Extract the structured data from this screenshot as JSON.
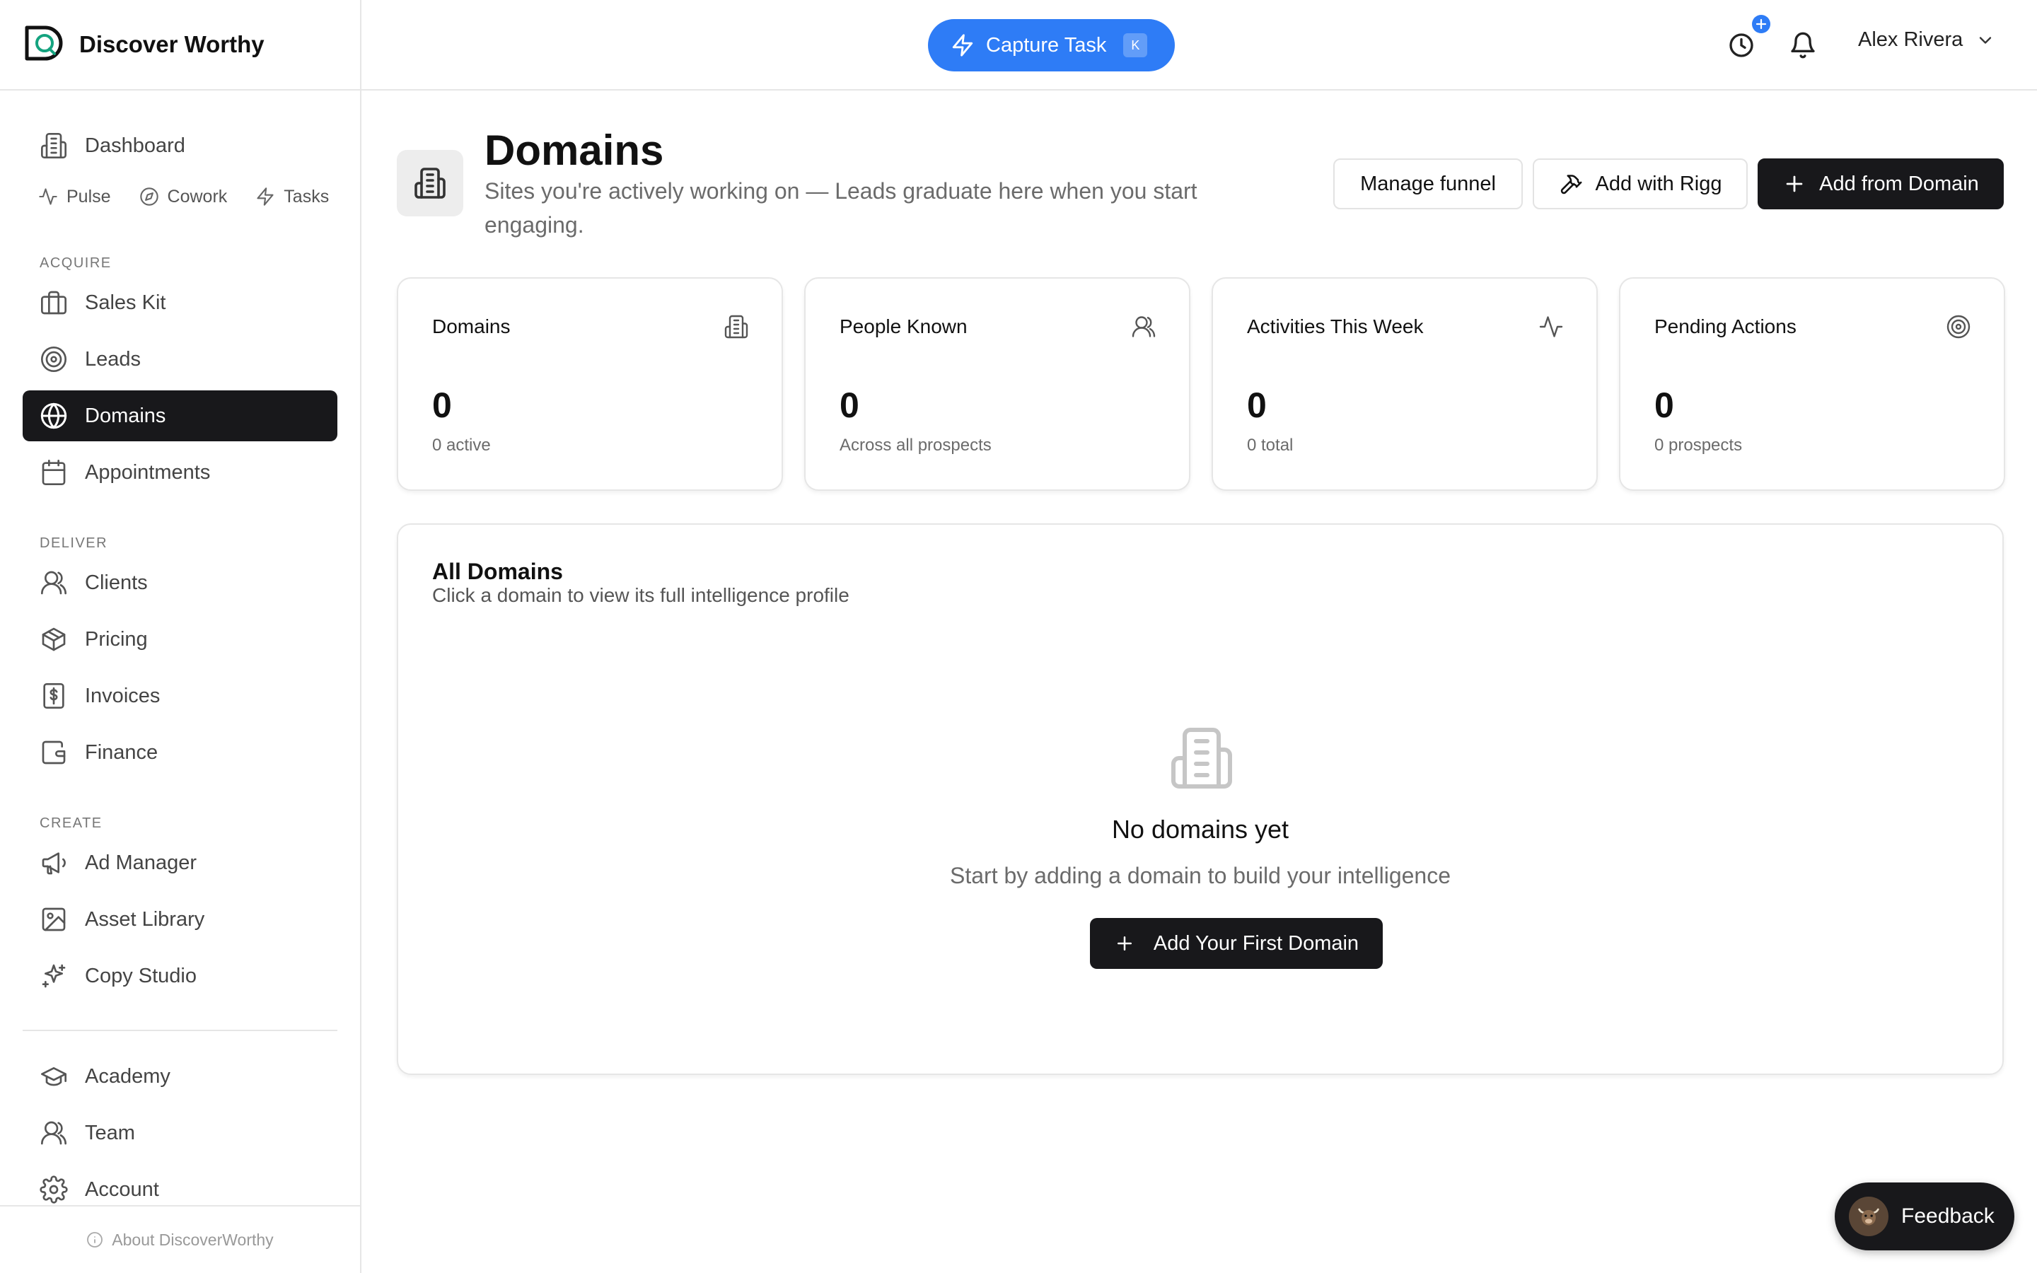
{
  "brand": {
    "name": "Discover Worthy"
  },
  "sidebar": {
    "dashboard": "Dashboard",
    "sub_items": [
      "Pulse",
      "Cowork",
      "Tasks"
    ],
    "sections": {
      "acquire": {
        "label": "ACQUIRE",
        "items": [
          "Sales Kit",
          "Leads",
          "Domains",
          "Appointments"
        ]
      },
      "deliver": {
        "label": "DELIVER",
        "items": [
          "Clients",
          "Pricing",
          "Invoices",
          "Finance"
        ]
      },
      "create": {
        "label": "CREATE",
        "items": [
          "Ad Manager",
          "Asset Library",
          "Copy Studio"
        ]
      }
    },
    "bottom_items": [
      "Academy",
      "Team",
      "Account"
    ],
    "footer": "About DiscoverWorthy",
    "active_item": "Domains"
  },
  "topbar": {
    "capture_label": "Capture Task",
    "capture_shortcut": "K",
    "user_name": "Alex Rivera",
    "accent_color": "#2e7cf6"
  },
  "page": {
    "title": "Domains",
    "subtitle": "Sites you're actively working on — Leads graduate here when you start engaging.",
    "actions": {
      "manage_funnel": "Manage funnel",
      "add_with_rigg": "Add with Rigg",
      "add_from_domain": "Add from Domain"
    }
  },
  "stats": [
    {
      "title": "Domains",
      "value": "0",
      "sub": "0 active",
      "icon": "building-icon"
    },
    {
      "title": "People Known",
      "value": "0",
      "sub": "Across all prospects",
      "icon": "users-icon"
    },
    {
      "title": "Activities This Week",
      "value": "0",
      "sub": "0 total",
      "icon": "activity-icon"
    },
    {
      "title": "Pending Actions",
      "value": "0",
      "sub": "0 prospects",
      "icon": "target-icon"
    }
  ],
  "panel": {
    "title": "All Domains",
    "subtitle": "Click a domain to view its full intelligence profile",
    "empty_title": "No domains yet",
    "empty_sub": "Start by adding a domain to build your intelligence",
    "empty_button": "Add Your First Domain"
  },
  "feedback": {
    "label": "Feedback"
  }
}
